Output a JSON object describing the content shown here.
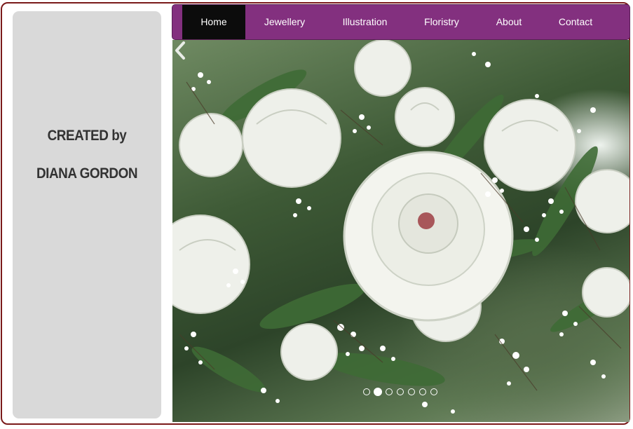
{
  "sidebar": {
    "credit_line1": "CREATED by",
    "credit_line2": "DIANA GORDON"
  },
  "nav": {
    "items": [
      {
        "label": "Home",
        "active": true
      },
      {
        "label": "Jewellery",
        "active": false
      },
      {
        "label": "Illustration",
        "active": false
      },
      {
        "label": "Floristry",
        "active": false
      },
      {
        "label": "About",
        "active": false
      },
      {
        "label": "Contact",
        "active": false
      }
    ]
  },
  "slider": {
    "slide_count": 7,
    "active_index": 1,
    "prev_icon": "chevron-left-icon"
  },
  "colors": {
    "nav_bg": "#83307f",
    "nav_active_bg": "#0c0c0c",
    "sidebar_bg": "#d9d9d9",
    "frame_border": "#7a1a1a",
    "credit_text": "#333333"
  }
}
